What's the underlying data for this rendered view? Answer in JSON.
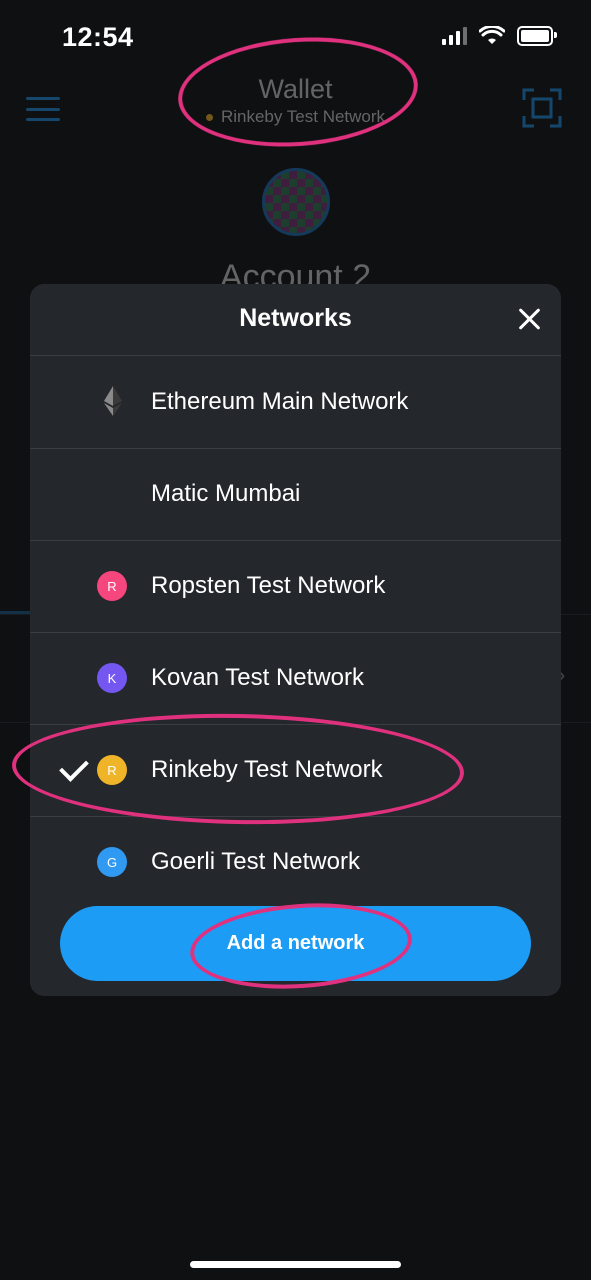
{
  "status_bar": {
    "time": "12:54"
  },
  "header": {
    "title": "Wallet",
    "network": "Rinkeby Test Network",
    "account_name": "Account 2"
  },
  "modal": {
    "title": "Networks",
    "networks": [
      {
        "label": "Ethereum Main Network",
        "icon": "ethereum-icon",
        "badge": "",
        "color": ""
      },
      {
        "label": "Matic Mumbai",
        "icon": "",
        "badge": "",
        "color": ""
      },
      {
        "label": "Ropsten Test Network",
        "icon": "badge",
        "badge": "R",
        "color": "#f5467d"
      },
      {
        "label": "Kovan Test Network",
        "icon": "badge",
        "badge": "K",
        "color": "#7457f0"
      },
      {
        "label": "Rinkeby Test Network",
        "icon": "badge",
        "badge": "R",
        "color": "#f0b429",
        "selected": true
      },
      {
        "label": "Goerli Test Network",
        "icon": "badge",
        "badge": "G",
        "color": "#3099f2"
      }
    ],
    "add_button": "Add a network"
  },
  "colors": {
    "accent": "#1c9cf5",
    "annotation": "#e0317f"
  }
}
